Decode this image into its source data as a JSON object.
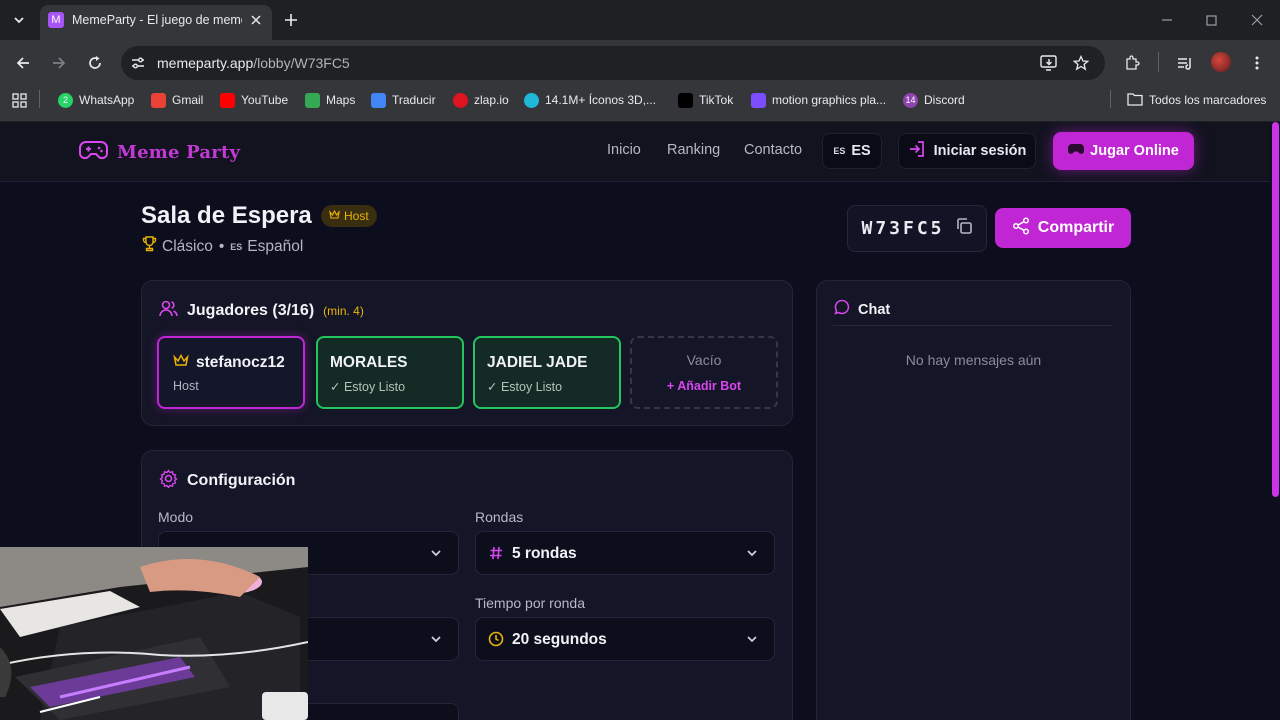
{
  "browser": {
    "tab_title": "MemeParty - El juego de meme",
    "tab_favicon_letter": "M",
    "url_host": "memeparty.app",
    "url_path": "/lobby/W73FC5",
    "bookmarks": [
      {
        "label": "WhatsApp",
        "icon": "whatsapp-icon",
        "color": "#25d366"
      },
      {
        "label": "Gmail",
        "icon": "gmail-icon",
        "color": "#ea4335"
      },
      {
        "label": "YouTube",
        "icon": "youtube-icon",
        "color": "#ff0000"
      },
      {
        "label": "Maps",
        "icon": "maps-icon",
        "color": "#34a853"
      },
      {
        "label": "Traducir",
        "icon": "translate-icon",
        "color": "#4285f4"
      },
      {
        "label": "zlap.io",
        "icon": "zlap-icon",
        "color": "#e0141e"
      },
      {
        "label": "14.1M+ Íconos 3D,...",
        "icon": "icons3d-icon",
        "color": "#1fb8d8"
      },
      {
        "label": "TikTok",
        "icon": "tiktok-icon",
        "color": "#000000"
      },
      {
        "label": "motion graphics pla...",
        "icon": "motion-icon",
        "color": "#7c4dff"
      },
      {
        "label": "Discord",
        "icon": "discord-icon",
        "color": "#8e44ad"
      }
    ],
    "all_bookmarks": "Todos los marcadores",
    "whatsapp_badge": "2",
    "discord_badge": "14"
  },
  "nav": {
    "logo": "Meme Party",
    "links": [
      "Inicio",
      "Ranking",
      "Contacto"
    ],
    "lang_code": "ES",
    "lang_label": "ES",
    "login": "Iniciar sesión",
    "play": "Jugar Online"
  },
  "lobby": {
    "title": "Sala de Espera",
    "host_badge": "Host",
    "mode": "Clásico",
    "bullet": "•",
    "lang_code": "ES",
    "lang": "Español",
    "room_code": "W73FC5",
    "share": "Compartir"
  },
  "players": {
    "title": "Jugadores (3/16)",
    "min": "(min. 4)",
    "list": [
      {
        "name": "stefanocz12",
        "status": "Host"
      },
      {
        "name": "MORALES",
        "status": "✓ Estoy Listo"
      },
      {
        "name": "JADIEL JADE",
        "status": "✓ Estoy Listo"
      }
    ],
    "empty": "Vacío",
    "add_bot": "+ Añadir Bot"
  },
  "config": {
    "title": "Configuración",
    "mode_label": "Modo",
    "rounds_label": "Rondas",
    "rounds_value": "5 rondas",
    "time_label": "Tiempo por ronda",
    "time_value": "20 segundos"
  },
  "chat": {
    "title": "Chat",
    "empty": "No hay mensajes aún"
  },
  "colors": {
    "accent": "#c026d3",
    "ready_green": "#22c55e",
    "host_gold": "#eab308"
  }
}
